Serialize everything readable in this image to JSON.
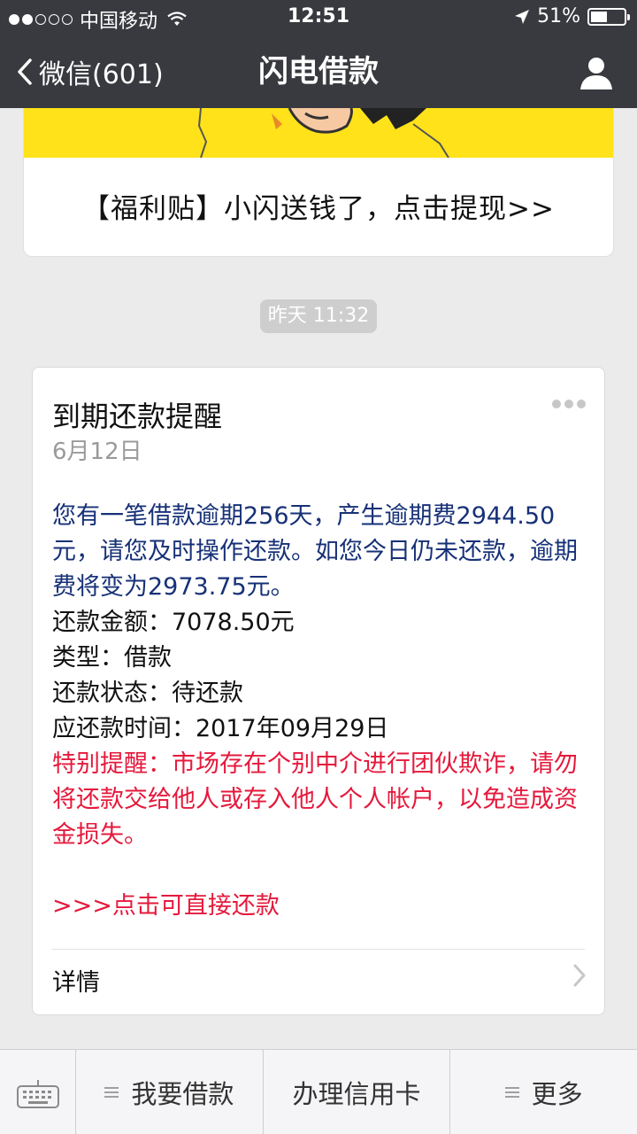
{
  "status_bar": {
    "carrier": "中国移动",
    "time": "12:51",
    "battery": "51%",
    "battery_level": 0.51,
    "signal_filled": 2,
    "signal_total": 5
  },
  "nav": {
    "back_label": "微信(601)",
    "title": "闪电借款",
    "profile_icon": "person-icon"
  },
  "promo": {
    "text": "【福利贴】小闪送钱了，点击提现>>",
    "banner_color": "#ffe21a"
  },
  "timestamp": "昨天 11:32",
  "message": {
    "title": "到期还款提醒",
    "date": "6月12日",
    "intro": "您有一笔借款逾期256天，产生逾期费2944.50元，请您及时操作还款。如您今日仍未还款，逾期费将变为2973.75元。",
    "amount": "还款金额：7078.50元",
    "type": "类型：借款",
    "status": "还款状态：待还款",
    "due_time": "应还款时间：2017年09月29日",
    "warning": "特别提醒：市场存在个别中介进行团伙欺诈，请勿将还款交给他人或存入他人个人帐户，以免造成资金损失。",
    "link": ">>>点击可直接还款",
    "detail_label": "详情",
    "colors": {
      "intro": "#173177",
      "warning": "#e5193c"
    }
  },
  "menu": {
    "keyboard_icon": "keyboard-icon",
    "items": [
      {
        "label": "我要借款",
        "has_submenu": true
      },
      {
        "label": "办理信用卡",
        "has_submenu": false
      },
      {
        "label": "更多",
        "has_submenu": true
      }
    ]
  }
}
